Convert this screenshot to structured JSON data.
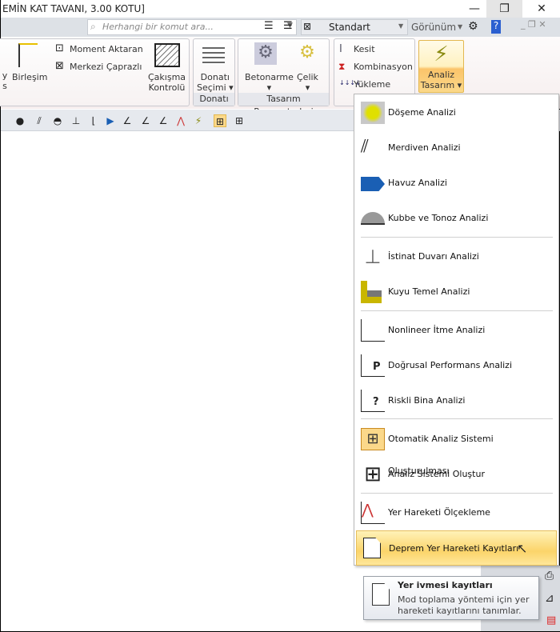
{
  "window": {
    "title": "EMİN KAT TAVANI,  3.00 KOTU]",
    "minimize": "—",
    "restore": "❐",
    "close": "✕"
  },
  "toolbar2": {
    "search_placeholder": "Herhangi bir komut ara...",
    "style_value": "Standart",
    "view_label": "Görünüm",
    "help": "?"
  },
  "ribbon": {
    "birlesim": "Birleşim",
    "cut_left": "y\ns",
    "moment": "Moment Aktaran",
    "merkezi": "Merkezi Çaprazlı",
    "cakisma": [
      "Çakışma",
      "Kontrolü"
    ],
    "donati_secimi": [
      "Donatı",
      "Seçimi ▾"
    ],
    "donati_group": "Donatı",
    "betonarme": "Betonarme",
    "celik": "Çelik",
    "tasarim_group": "Tasarım Parametreleri",
    "kesit": "Kesit",
    "kombinasyon": "Kombinasyon",
    "yukleme": "Yükleme",
    "analiz": [
      "Analiz",
      "Tasarım ▾"
    ]
  },
  "menu": {
    "items": [
      {
        "label": "Döşeme Analizi"
      },
      {
        "label": "Merdiven Analizi"
      },
      {
        "label": "Havuz Analizi"
      },
      {
        "label": "Kubbe ve Tonoz Analizi"
      },
      {
        "label": "İstinat Duvarı Analizi"
      },
      {
        "label": "Kuyu Temel Analizi"
      },
      {
        "label": "Nonlineer İtme Analizi"
      },
      {
        "label": "Doğrusal Performans Analizi"
      },
      {
        "label": "Riskli Bina Analizi"
      },
      {
        "label": "Otomatik Analiz Sistemi Oluşturulması"
      },
      {
        "label": "Analiz Sistemi Oluştur"
      },
      {
        "label": "Yer Hareketi Ölçekleme"
      },
      {
        "label": "Deprem Yer Hareketi Kayıtları"
      }
    ]
  },
  "tooltip": {
    "title": "Yer ivmesi kayıtları",
    "body": "Mod toplama yöntemi için yer hareketi kayıtlarını tanımlar."
  }
}
